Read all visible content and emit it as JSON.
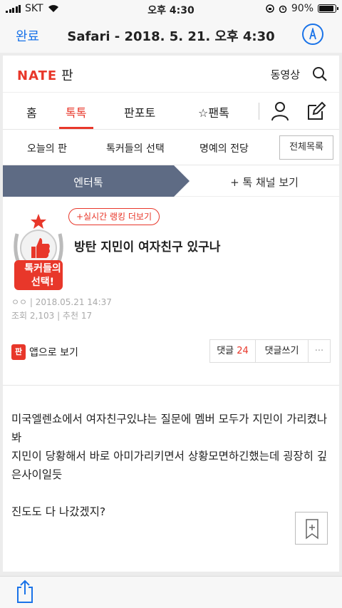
{
  "status_bar": {
    "carrier": "SKT",
    "time": "오후 4:30",
    "battery": "90%",
    "battery_level": 0.9
  },
  "safari_header": {
    "done_label": "완료",
    "title": "Safari - 2018. 5. 21. 오후 4:30",
    "markup_icon": "pen-markup-icon"
  },
  "site_header": {
    "logo": "NATE",
    "logo_section": "판",
    "video_label": "동영상",
    "search_icon": "search-icon"
  },
  "main_tabs": [
    {
      "label": "홈"
    },
    {
      "label": "톡톡"
    },
    {
      "label": "판포토"
    },
    {
      "label": "☆팬톡"
    }
  ],
  "sub_tabs": [
    {
      "label": "오늘의 판"
    },
    {
      "label": "톡커들의 선택"
    },
    {
      "label": "명예의 전당"
    }
  ],
  "full_list_label": "전체목록",
  "channel": {
    "current": "엔터톡",
    "more": "+ 톡 채널 보기"
  },
  "post": {
    "badge_line1": "톡커들의",
    "badge_line2": "선택!",
    "rank_label": "+실시간 랭킹 더보기",
    "title": "방탄 지민이 여자친구 있구나",
    "author": "ㅇㅇ",
    "date": "| 2018.05.21 14:37",
    "views": "조회 2,103",
    "recommends": "추천 17",
    "app_label": "앱으로 보기",
    "app_icon": "판",
    "comment_label": "댓글",
    "comment_count": "24",
    "write_comment_label": "댓글쓰기",
    "more_label": "···"
  },
  "body_text": {
    "line1": "미국엘렌쇼에서 여자친구있냐는 질문에 멤버 모두가 지민이 가리켰나",
    "line2": "봐",
    "line3": "지민이 당황해서 바로 아미가리키면서 상황모면하긴했는데 굉장히 깊",
    "line4": "은사이일듯",
    "line5": "진도도 다 나갔겠지?"
  },
  "toolbar": {
    "share_icon": "share-icon"
  }
}
